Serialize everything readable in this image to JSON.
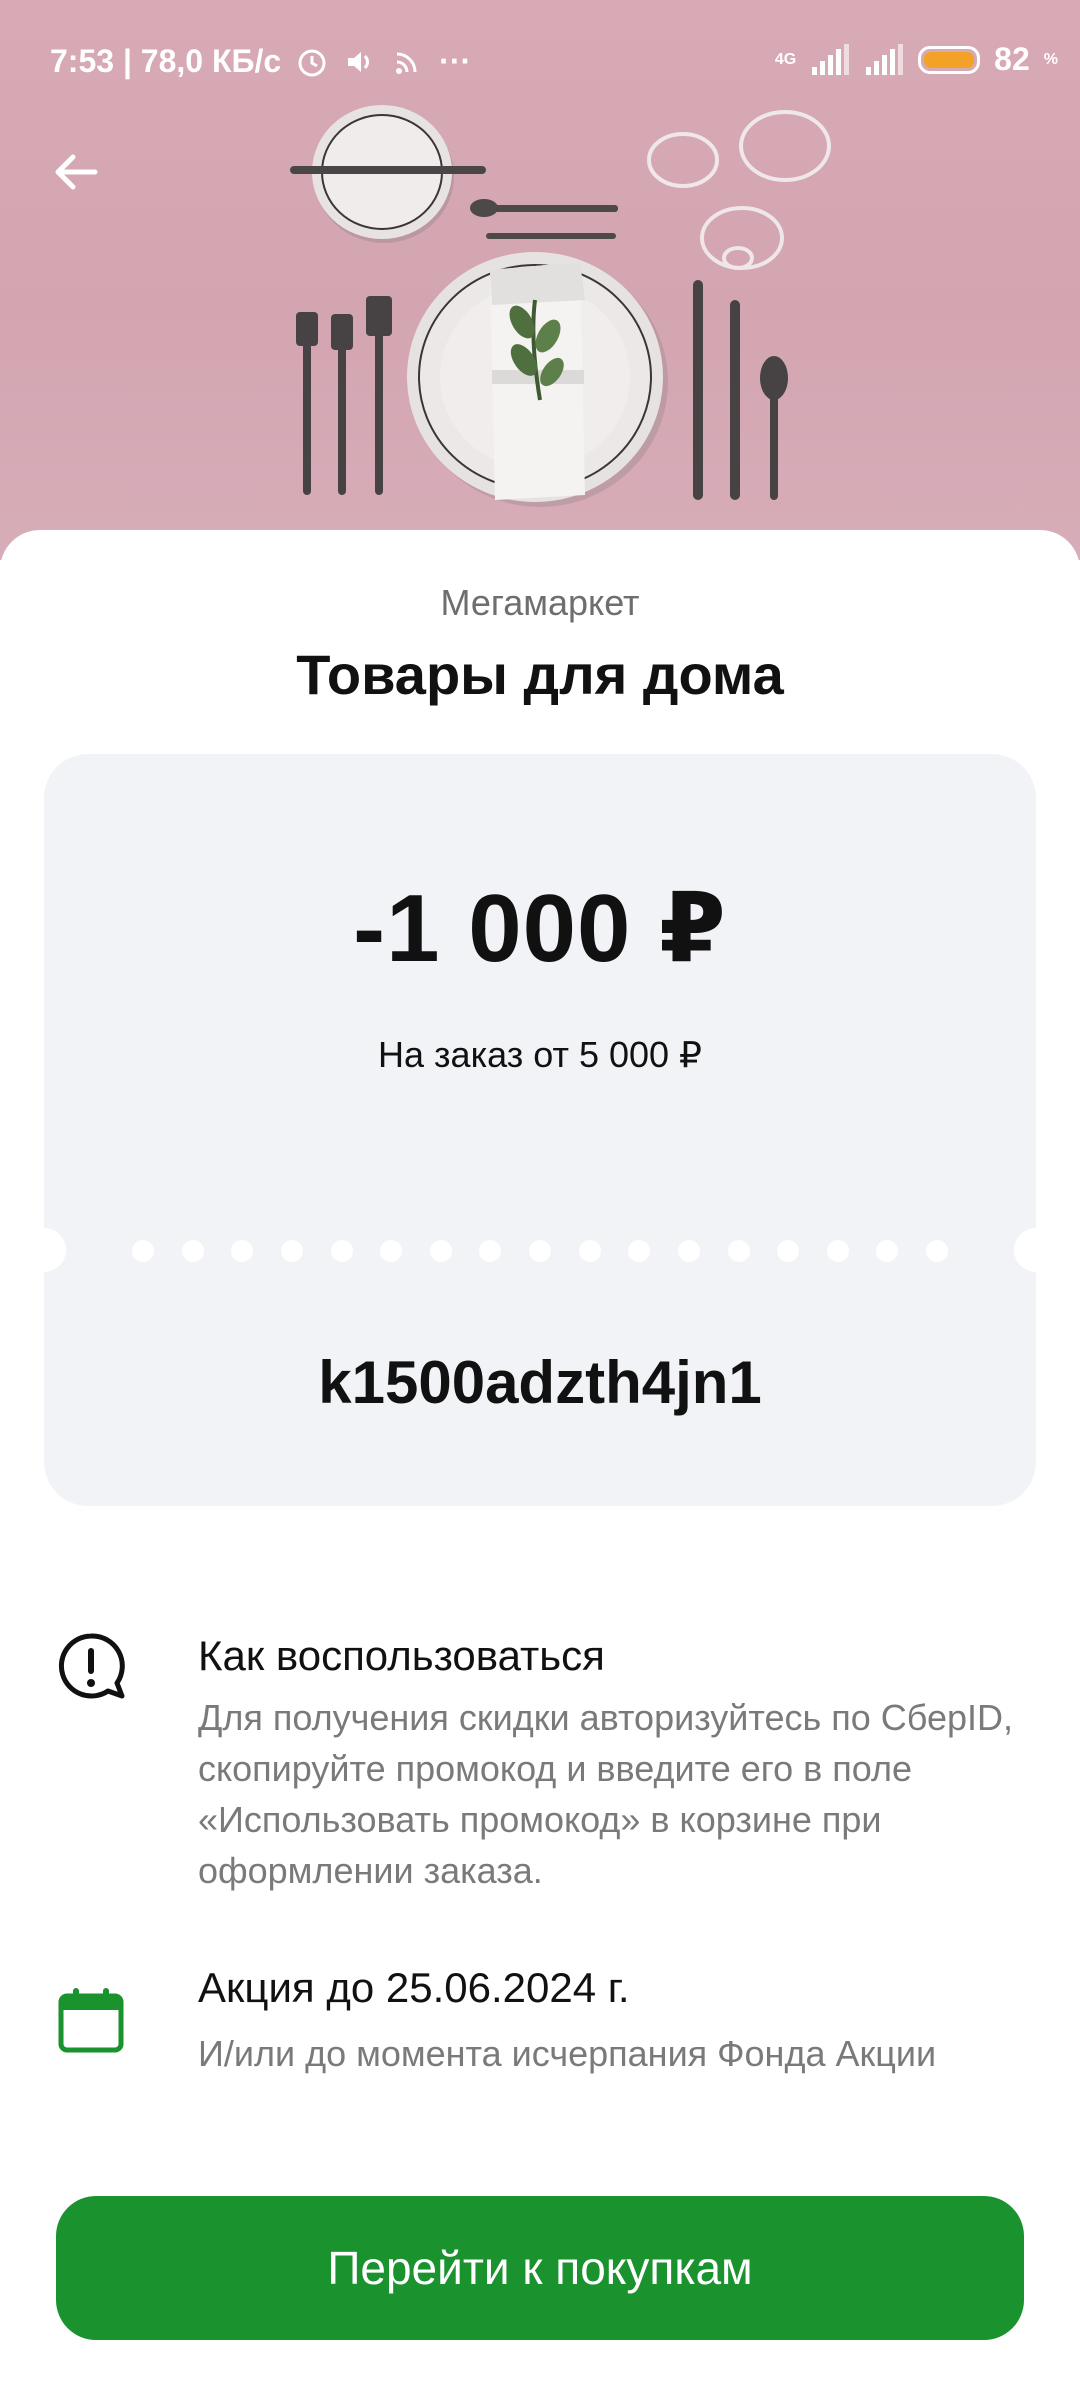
{
  "status_bar": {
    "time_speed": "7:53 | 78,0 КБ/с",
    "more": "···",
    "network": "4G",
    "battery_level": "82",
    "battery_unit": "%"
  },
  "hero": {
    "image_icon": "table-setting-illustration",
    "back_icon": "arrow-left-icon"
  },
  "offer": {
    "brand": "Мегамаркет",
    "title": "Товары для дома",
    "amount": "-1 000 ₽",
    "condition": "На заказ от 5 000 ₽",
    "promo_code": "k1500adzth4jn1"
  },
  "how_to": {
    "icon": "alert-bubble-icon",
    "heading": "Как воспользоваться",
    "text": "Для получения скидки авторизуйтесь по СберID, скопируйте промокод и введите его в поле «Использовать промокод» в корзине при оформлении заказа."
  },
  "promo_period": {
    "icon": "calendar-icon",
    "heading": "Акция до 25.06.2024 г.",
    "text": "И/или до момента исчерпания Фонда Акции"
  },
  "cta": {
    "label": "Перейти к покупкам"
  },
  "colors": {
    "accent": "#1a922e",
    "hero_bg": "#d5a8b4",
    "card_bg": "#f1f3f6",
    "battery": "#f2a227"
  }
}
